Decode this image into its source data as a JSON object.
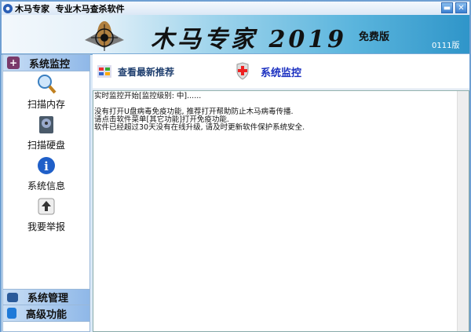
{
  "window": {
    "title": "木马专家  专业木马查杀软件",
    "minimize": "▬",
    "close": "✕"
  },
  "banner": {
    "title": "木马专家 2019",
    "edition": "免费版",
    "version": "0111版"
  },
  "sidebar": {
    "header": "系统监控",
    "tools": [
      {
        "label": "扫描内存",
        "icon": "magnifier-icon"
      },
      {
        "label": "扫描硬盘",
        "icon": "disk-icon"
      },
      {
        "label": "系统信息",
        "icon": "info-icon"
      },
      {
        "label": "我要举报",
        "icon": "report-icon"
      }
    ],
    "sections": [
      "系统管理",
      "高级功能"
    ]
  },
  "main": {
    "recommend": "查看最新推荐",
    "monitor": "系统监控",
    "log": [
      "实时监控开始[监控级别: 中]......",
      "",
      "没有打开U盘病毒免疫功能, 推荐打开帮助防止木马病毒传播.",
      "请点击软件菜单[其它功能]打开免疫功能.",
      "软件已经超过30天没有在线升级, 请及时更新软件保护系统安全."
    ]
  }
}
